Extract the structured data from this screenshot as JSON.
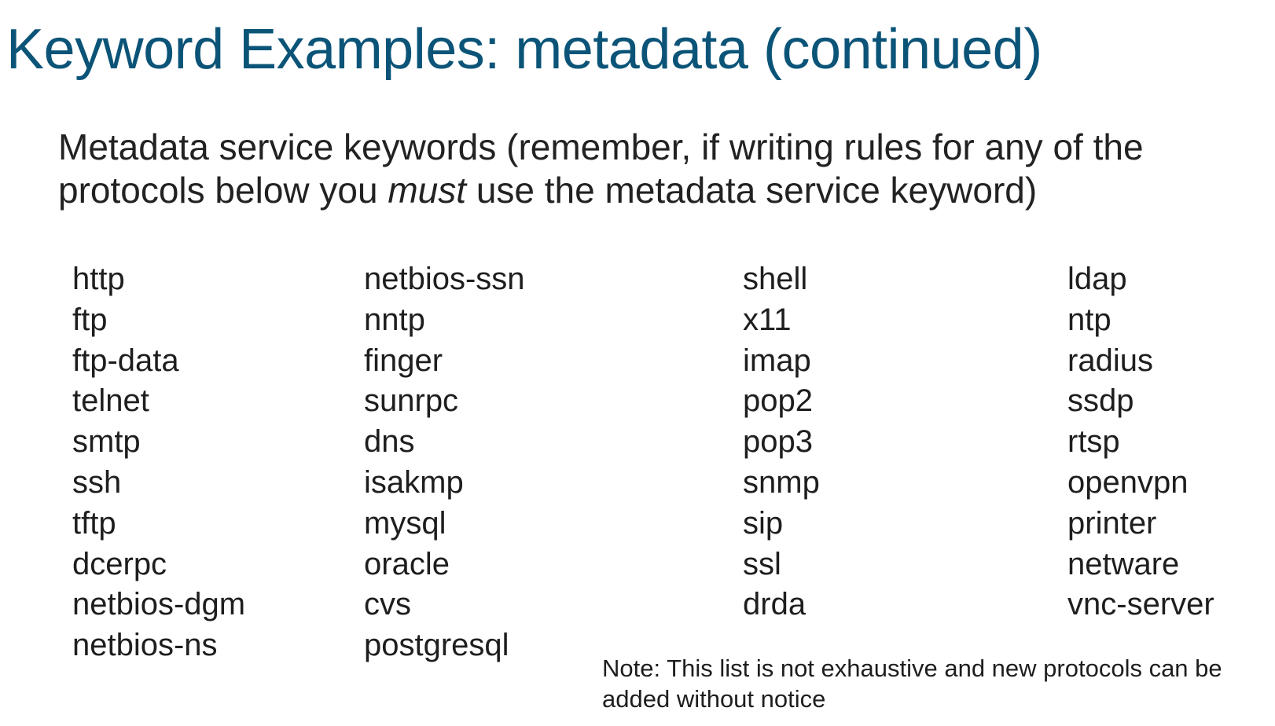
{
  "slide": {
    "title": "Keyword Examples: metadata (continued)",
    "intro_before": "Metadata service keywords (remember, if writing rules for any of the protocols below you ",
    "intro_emphasis": "must",
    "intro_after": " use the metadata service keyword)",
    "columns": [
      [
        "http",
        "ftp",
        "ftp-data",
        "telnet",
        "smtp",
        "ssh",
        "tftp",
        "dcerpc",
        "netbios-dgm",
        "netbios-ns"
      ],
      [
        "netbios-ssn",
        "nntp",
        "finger",
        "sunrpc",
        "dns",
        "isakmp",
        "mysql",
        "oracle",
        "cvs",
        "postgresql"
      ],
      [
        "shell",
        "x11",
        "imap",
        "pop2",
        "pop3",
        "snmp",
        "sip",
        "ssl",
        "drda"
      ],
      [
        "ldap",
        "ntp",
        "radius",
        "ssdp",
        "rtsp",
        "openvpn",
        "printer",
        "netware",
        "vnc-server"
      ]
    ],
    "note": "Note: This list is not exhaustive and new protocols can be added without notice"
  }
}
